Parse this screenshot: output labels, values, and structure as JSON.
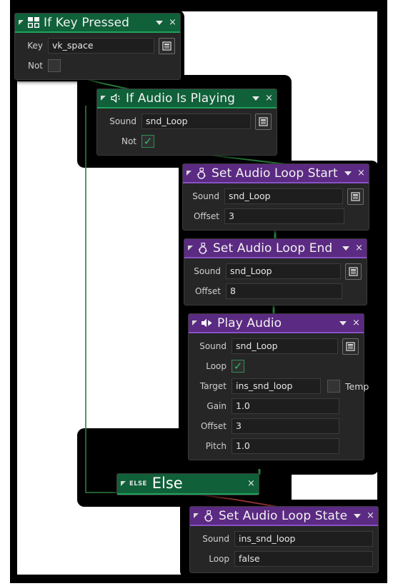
{
  "canvas": {
    "background_color": "#ffffff",
    "shadow_color": "#000000"
  },
  "colors": {
    "condition_header": "#106039",
    "condition_accent": "#1ea35c",
    "action_header": "#5b2a82",
    "action_accent": "#8a52c4",
    "node_body": "#262626",
    "field_background": "#1e1e1e",
    "wire_true": "#2a7d3f",
    "wire_false": "#8c3030",
    "checkbox_check": "#2fbd68"
  },
  "nodes": [
    {
      "id": "if-key-pressed",
      "title": "If Key Pressed",
      "icon": "keyboard-grid-icon",
      "type": "condition",
      "has_caret": true,
      "has_close": true,
      "rows": [
        {
          "label": "Key",
          "value": "vk_space",
          "control": "text",
          "menu_button": true
        },
        {
          "label": "Not",
          "value": "",
          "control": "checkbox",
          "checked": false
        }
      ]
    },
    {
      "id": "if-audio-is-playing",
      "title": "If Audio Is Playing",
      "icon": "audio-dashed-icon",
      "type": "condition",
      "has_caret": true,
      "has_close": true,
      "rows": [
        {
          "label": "Sound",
          "value": "snd_Loop",
          "control": "text",
          "menu_button": true
        },
        {
          "label": "Not",
          "value": "",
          "control": "checkbox",
          "checked": true
        }
      ]
    },
    {
      "id": "set-audio-loop-start",
      "title": "Set Audio Loop Start",
      "icon": "audio-loop-icon",
      "type": "action",
      "has_caret": true,
      "has_close": true,
      "rows": [
        {
          "label": "Sound",
          "value": "snd_Loop",
          "control": "text",
          "menu_button": true
        },
        {
          "label": "Offset",
          "value": "3",
          "control": "text",
          "menu_button": false
        }
      ]
    },
    {
      "id": "set-audio-loop-end",
      "title": "Set Audio Loop End",
      "icon": "audio-loop-icon",
      "type": "action",
      "has_caret": true,
      "has_close": true,
      "rows": [
        {
          "label": "Sound",
          "value": "snd_Loop",
          "control": "text",
          "menu_button": true
        },
        {
          "label": "Offset",
          "value": "8",
          "control": "text",
          "menu_button": false
        }
      ]
    },
    {
      "id": "play-audio",
      "title": "Play Audio",
      "icon": "speaker-play-icon",
      "type": "action",
      "has_caret": true,
      "has_close": true,
      "rows": [
        {
          "label": "Sound",
          "value": "snd_Loop",
          "control": "text",
          "menu_button": true
        },
        {
          "label": "Loop",
          "value": "",
          "control": "checkbox",
          "checked": true
        },
        {
          "label": "Target",
          "value": "ins_snd_loop",
          "control": "text-temp",
          "temp_label": "Temp",
          "temp_checked": false
        },
        {
          "label": "Gain",
          "value": "1.0",
          "control": "text",
          "menu_button": false
        },
        {
          "label": "Offset",
          "value": "3",
          "control": "text",
          "menu_button": false
        },
        {
          "label": "Pitch",
          "value": "1.0",
          "control": "text",
          "menu_button": false
        }
      ]
    },
    {
      "id": "else",
      "title": "Else",
      "tag": "ELSE",
      "icon": "else-tag-icon",
      "type": "condition",
      "has_caret": false,
      "has_close": true,
      "rows": []
    },
    {
      "id": "set-audio-loop-state",
      "title": "Set Audio Loop State",
      "icon": "audio-loop-icon",
      "type": "action",
      "has_caret": true,
      "has_close": true,
      "rows": [
        {
          "label": "Sound",
          "value": "ins_snd_loop",
          "control": "text",
          "menu_button": false
        },
        {
          "label": "Loop",
          "value": "false",
          "control": "text",
          "menu_button": false
        }
      ]
    }
  ],
  "close_glyph": "×"
}
